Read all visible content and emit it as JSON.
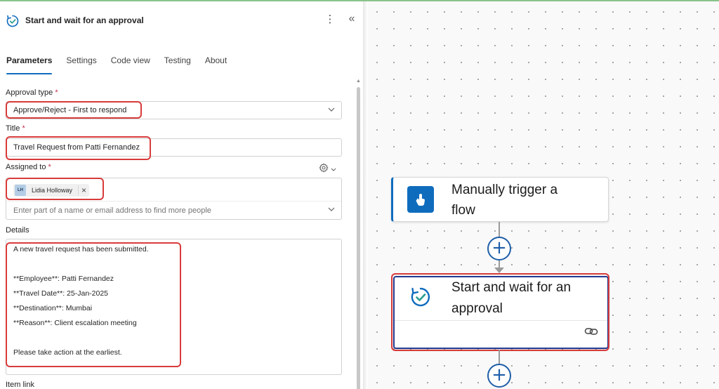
{
  "panel": {
    "title": "Start and wait for an approval",
    "more_label": "⋮",
    "collapse_label": "«",
    "tabs": [
      {
        "label": "Parameters",
        "active": true
      },
      {
        "label": "Settings",
        "active": false
      },
      {
        "label": "Code view",
        "active": false
      },
      {
        "label": "Testing",
        "active": false
      },
      {
        "label": "About",
        "active": false
      }
    ],
    "approval_type": {
      "label": "Approval type",
      "required_mark": "*",
      "value": "Approve/Reject - First to respond"
    },
    "title_field": {
      "label": "Title",
      "required_mark": "*",
      "value": "Travel Request from Patti Fernandez"
    },
    "assigned_to": {
      "label": "Assigned to",
      "required_mark": "*",
      "chip_initials": "LH",
      "chip_name": "Lidia Holloway",
      "placeholder": "Enter part of a name or email address to find more people"
    },
    "details": {
      "label": "Details",
      "lines": [
        "A new travel request has been submitted.",
        "",
        "**Employee**: Patti Fernandez",
        "**Travel Date**: 25-Jan-2025",
        "**Destination**: Mumbai",
        "**Reason**: Client escalation meeting",
        "",
        "Please take action at the earliest."
      ]
    },
    "item_link": {
      "label": "Item link"
    }
  },
  "canvas": {
    "trigger_card": {
      "title_line1": "Manually trigger a",
      "title_line2": "flow"
    },
    "approval_card": {
      "title_line1": "Start and wait for an",
      "title_line2": "approval"
    },
    "add_step_label": "+"
  },
  "colors": {
    "accent": "#0f6cbd",
    "highlight_red": "#d83b3b",
    "required": "#c4314b",
    "approval_icon": "#0f6cbd",
    "approval_check": "#2a9d8f"
  },
  "icons": {
    "header": "approval-icon",
    "more": "more-vertical-icon",
    "collapse": "double-chevron-left-icon",
    "dropdown": "chevron-down-icon",
    "settings": "gear-icon",
    "remove": "close-icon",
    "trigger": "touch-icon",
    "link": "link-icon",
    "add": "plus-icon"
  }
}
